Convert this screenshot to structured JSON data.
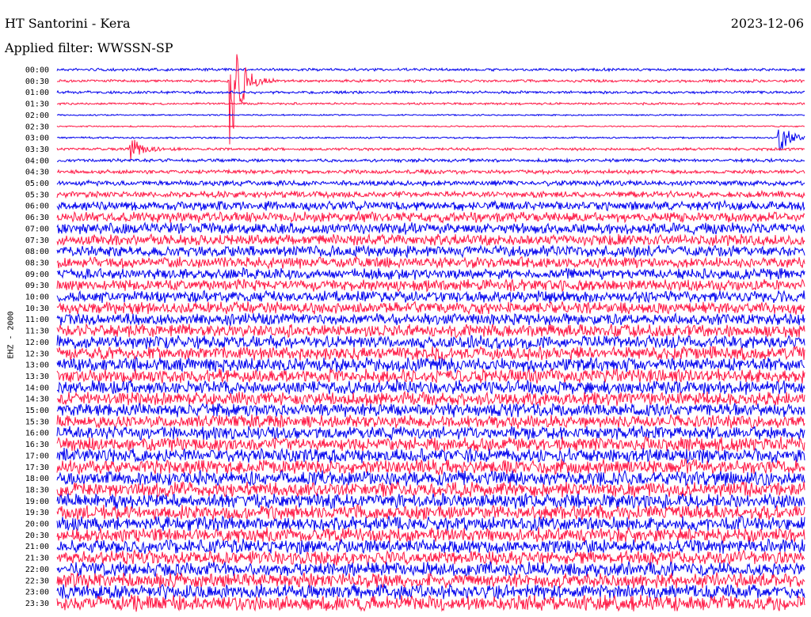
{
  "header": {
    "title": "HT Santorini - Kera",
    "date": "2023-12-06",
    "filter": "Applied filter: WWSSN-SP"
  },
  "chart_data": {
    "type": "line",
    "ylabel": "EHZ - 2000",
    "colors": [
      "#0000ee",
      "#ff1744"
    ],
    "row_labels": [
      "00:00",
      "00:30",
      "01:00",
      "01:30",
      "02:00",
      "02:30",
      "03:00",
      "03:30",
      "04:00",
      "04:30",
      "05:00",
      "05:30",
      "06:00",
      "06:30",
      "07:00",
      "07:30",
      "08:00",
      "08:30",
      "09:00",
      "09:30",
      "10:00",
      "10:30",
      "11:00",
      "11:30",
      "12:00",
      "12:30",
      "13:00",
      "13:30",
      "14:00",
      "14:30",
      "15:00",
      "15:30",
      "16:00",
      "16:30",
      "17:00",
      "17:30",
      "18:00",
      "18:30",
      "19:00",
      "19:30",
      "20:00",
      "20:30",
      "21:00",
      "21:30",
      "22:00",
      "22:30",
      "23:00",
      "23:30"
    ],
    "relative_noise_amplitude": [
      0.15,
      0.15,
      0.15,
      0.12,
      0.08,
      0.08,
      0.1,
      0.15,
      0.18,
      0.22,
      0.28,
      0.35,
      0.5,
      0.55,
      0.6,
      0.6,
      0.6,
      0.6,
      0.6,
      0.62,
      0.62,
      0.65,
      0.65,
      0.7,
      0.7,
      0.72,
      0.75,
      0.75,
      0.75,
      0.72,
      0.72,
      0.7,
      0.72,
      0.75,
      0.78,
      0.78,
      0.8,
      0.8,
      0.8,
      0.78,
      0.78,
      0.78,
      0.78,
      0.78,
      0.8,
      0.8,
      0.8,
      0.85
    ],
    "events": [
      {
        "time": "00:30",
        "minute": 14,
        "amplitude": 6
      },
      {
        "time": "03:00",
        "minute": 58,
        "amplitude": 1.5
      },
      {
        "time": "03:30",
        "minute": 6,
        "amplitude": 1
      }
    ]
  }
}
